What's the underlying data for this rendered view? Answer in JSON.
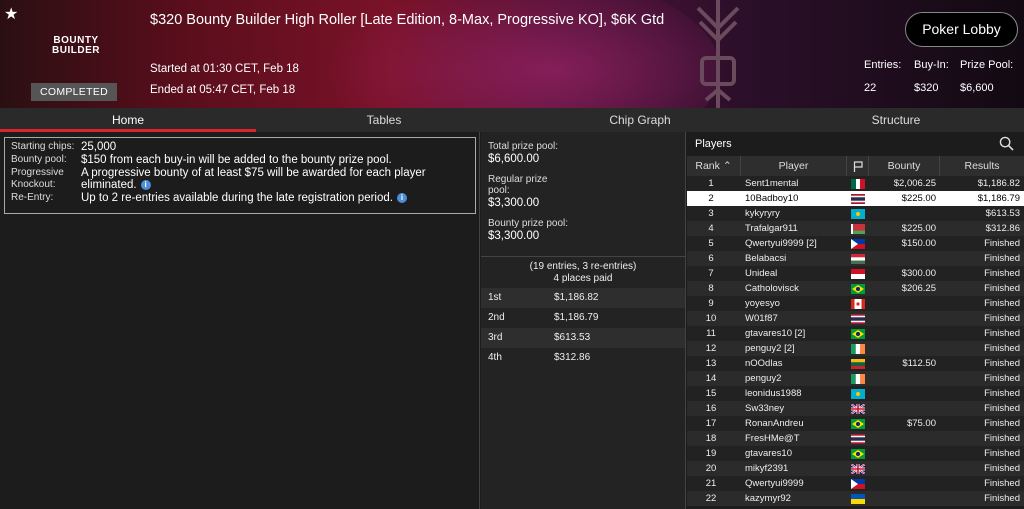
{
  "header": {
    "title": "$320 Bounty Builder High Roller [Late Edition, 8-Max, Progressive KO], $6K Gtd",
    "logo_line1": "BOUNTY",
    "logo_line2": "BUILDER",
    "status_badge": "COMPLETED",
    "started": "Started at 01:30 CET, Feb 18",
    "ended": "Ended at 05:47 CET, Feb 18",
    "lobby_button": "Poker Lobby",
    "stats": {
      "entries_label": "Entries:",
      "entries_value": "22",
      "buyin_label": "Buy-In:",
      "buyin_value": "$320",
      "prizepool_label": "Prize Pool:",
      "prizepool_value": "$6,600"
    }
  },
  "tabs": [
    "Home",
    "Tables",
    "Chip Graph",
    "Structure"
  ],
  "info": {
    "starting_chips_label": "Starting chips:",
    "starting_chips": "25,000",
    "bounty_pool_label": "Bounty pool:",
    "bounty_pool": "$150 from each buy-in will be added to the bounty prize pool.",
    "pko_label_1": "Progressive",
    "pko_label_2": "Knockout:",
    "pko_line1": "A progressive bounty of at least $75 will be awarded for each player",
    "pko_line2": "eliminated.",
    "reentry_label": "Re-Entry:",
    "reentry": "Up to 2 re-entries available during the late registration period."
  },
  "prize": {
    "total_label": "Total prize pool:",
    "total": "$6,600.00",
    "regular_label_1": "Regular prize",
    "regular_label_2": "pool:",
    "regular": "$3,300.00",
    "bounty_label": "Bounty prize pool:",
    "bounty": "$3,300.00",
    "entries_note": "(19 entries, 3 re-entries)",
    "places_paid": "4 places paid",
    "payouts": [
      {
        "place": "1st",
        "amount": "$1,186.82"
      },
      {
        "place": "2nd",
        "amount": "$1,186.79"
      },
      {
        "place": "3rd",
        "amount": "$613.53"
      },
      {
        "place": "4th",
        "amount": "$312.86"
      }
    ]
  },
  "players": {
    "title": "Players",
    "columns": {
      "rank": "Rank",
      "player": "Player",
      "bounty": "Bounty",
      "results": "Results"
    },
    "rows": [
      {
        "rank": "1",
        "name": "Sent1mental",
        "flag": "mx",
        "bounty": "$2,006.25",
        "result": "$1,186.82"
      },
      {
        "rank": "2",
        "name": "10Badboy10",
        "flag": "th",
        "bounty": "$225.00",
        "result": "$1,186.79"
      },
      {
        "rank": "3",
        "name": "kykyryry",
        "flag": "kz",
        "bounty": "",
        "result": "$613.53"
      },
      {
        "rank": "4",
        "name": "Trafalgar911",
        "flag": "by",
        "bounty": "$225.00",
        "result": "$312.86"
      },
      {
        "rank": "5",
        "name": "Qwertyui9999 [2]",
        "flag": "ph",
        "bounty": "$150.00",
        "result": "Finished"
      },
      {
        "rank": "6",
        "name": "Belabacsi",
        "flag": "hu",
        "bounty": "",
        "result": "Finished"
      },
      {
        "rank": "7",
        "name": "Unideal",
        "flag": "id",
        "bounty": "$300.00",
        "result": "Finished"
      },
      {
        "rank": "8",
        "name": "Catholovisck",
        "flag": "br",
        "bounty": "$206.25",
        "result": "Finished"
      },
      {
        "rank": "9",
        "name": "yoyesyo",
        "flag": "ca",
        "bounty": "",
        "result": "Finished"
      },
      {
        "rank": "10",
        "name": "W01f87",
        "flag": "th",
        "bounty": "",
        "result": "Finished"
      },
      {
        "rank": "11",
        "name": "gtavares10 [2]",
        "flag": "br",
        "bounty": "",
        "result": "Finished"
      },
      {
        "rank": "12",
        "name": "penguy2 [2]",
        "flag": "ie",
        "bounty": "",
        "result": "Finished"
      },
      {
        "rank": "13",
        "name": "nOOdlas",
        "flag": "lt",
        "bounty": "$112.50",
        "result": "Finished"
      },
      {
        "rank": "14",
        "name": "penguy2",
        "flag": "ie",
        "bounty": "",
        "result": "Finished"
      },
      {
        "rank": "15",
        "name": "leonidus1988",
        "flag": "kz",
        "bounty": "",
        "result": "Finished"
      },
      {
        "rank": "16",
        "name": "Sw33ney",
        "flag": "gb",
        "bounty": "",
        "result": "Finished"
      },
      {
        "rank": "17",
        "name": "RonanAndreu",
        "flag": "br",
        "bounty": "$75.00",
        "result": "Finished"
      },
      {
        "rank": "18",
        "name": "FresHMe@T",
        "flag": "th",
        "bounty": "",
        "result": "Finished"
      },
      {
        "rank": "19",
        "name": "gtavares10",
        "flag": "br",
        "bounty": "",
        "result": "Finished"
      },
      {
        "rank": "20",
        "name": "mikyf2391",
        "flag": "gb",
        "bounty": "",
        "result": "Finished"
      },
      {
        "rank": "21",
        "name": "Qwertyui9999",
        "flag": "ph",
        "bounty": "",
        "result": "Finished"
      },
      {
        "rank": "22",
        "name": "kazymyr92",
        "flag": "ua",
        "bounty": "",
        "result": "Finished"
      }
    ]
  },
  "colors": {
    "accent": "#d9242e",
    "selected_row": "#ffffff"
  }
}
